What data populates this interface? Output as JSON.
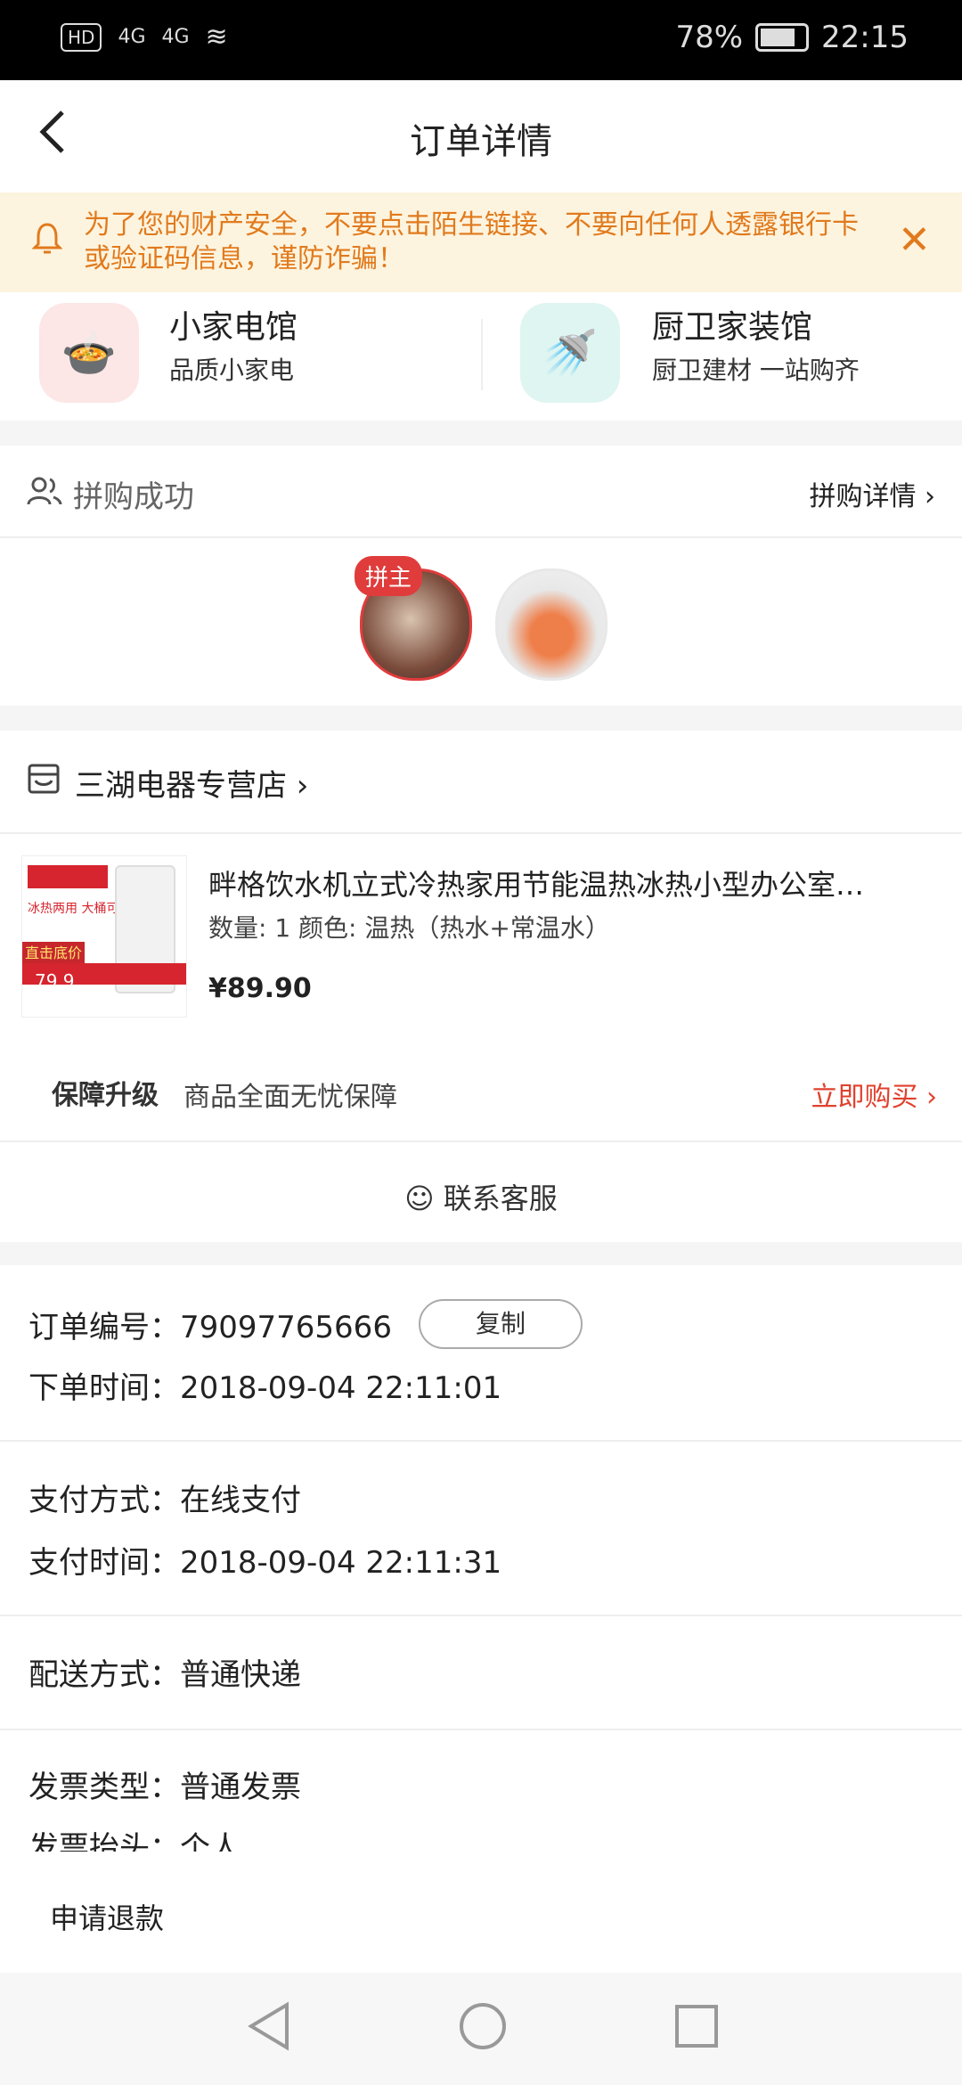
{
  "status_bar": {
    "hd": "HD",
    "signal1": "4G",
    "signal2": "4G",
    "battery": "78%",
    "time": "22:15"
  },
  "header": {
    "title": "订单详情"
  },
  "notice": {
    "text": "为了您的财产安全，不要点击陌生链接、不要向任何人透露银行卡或验证码信息，谨防诈骗！"
  },
  "categories": [
    {
      "title": "小家电馆",
      "subtitle": "品质小家电"
    },
    {
      "title": "厨卫家装馆",
      "subtitle": "厨卫建材 一站购齐"
    }
  ],
  "group_buy": {
    "title": "拼购成功",
    "detail_link": "拼购详情 ›",
    "leader_badge": "拼主"
  },
  "store": {
    "name": "三湖电器专营店 ›",
    "thumb_tag": "直击底价",
    "thumb_text": "冰热两用 大桶可用",
    "thumb_price": "79.9",
    "product_name": "畔格饮水机立式冷热家用节能温热冰热小型办公室…",
    "product_spec": "数量: 1 颜色: 温热（热水+常温水）",
    "product_price": "¥89.90",
    "warranty_label": "保障升级",
    "warranty_desc": "商品全面无忧保障",
    "buy_now": "立即购买 ›",
    "service": "联系客服"
  },
  "order_info": {
    "order_no": "订单编号：79097765666",
    "copy_label": "复制",
    "order_time": "下单时间：2018-09-04 22:11:01",
    "pay_method": "支付方式：在线支付",
    "pay_time": "支付时间：2018-09-04 22:11:31",
    "delivery": "配送方式：普通快递",
    "invoice_type": "发票类型：普通发票",
    "invoice_title": "发票抬头：个人"
  },
  "bottom_bar": {
    "refund": "申请退款"
  },
  "colors": {
    "accent": "#e0412d",
    "notice": "#e17a1d",
    "notice_bg": "#fdf4df"
  }
}
